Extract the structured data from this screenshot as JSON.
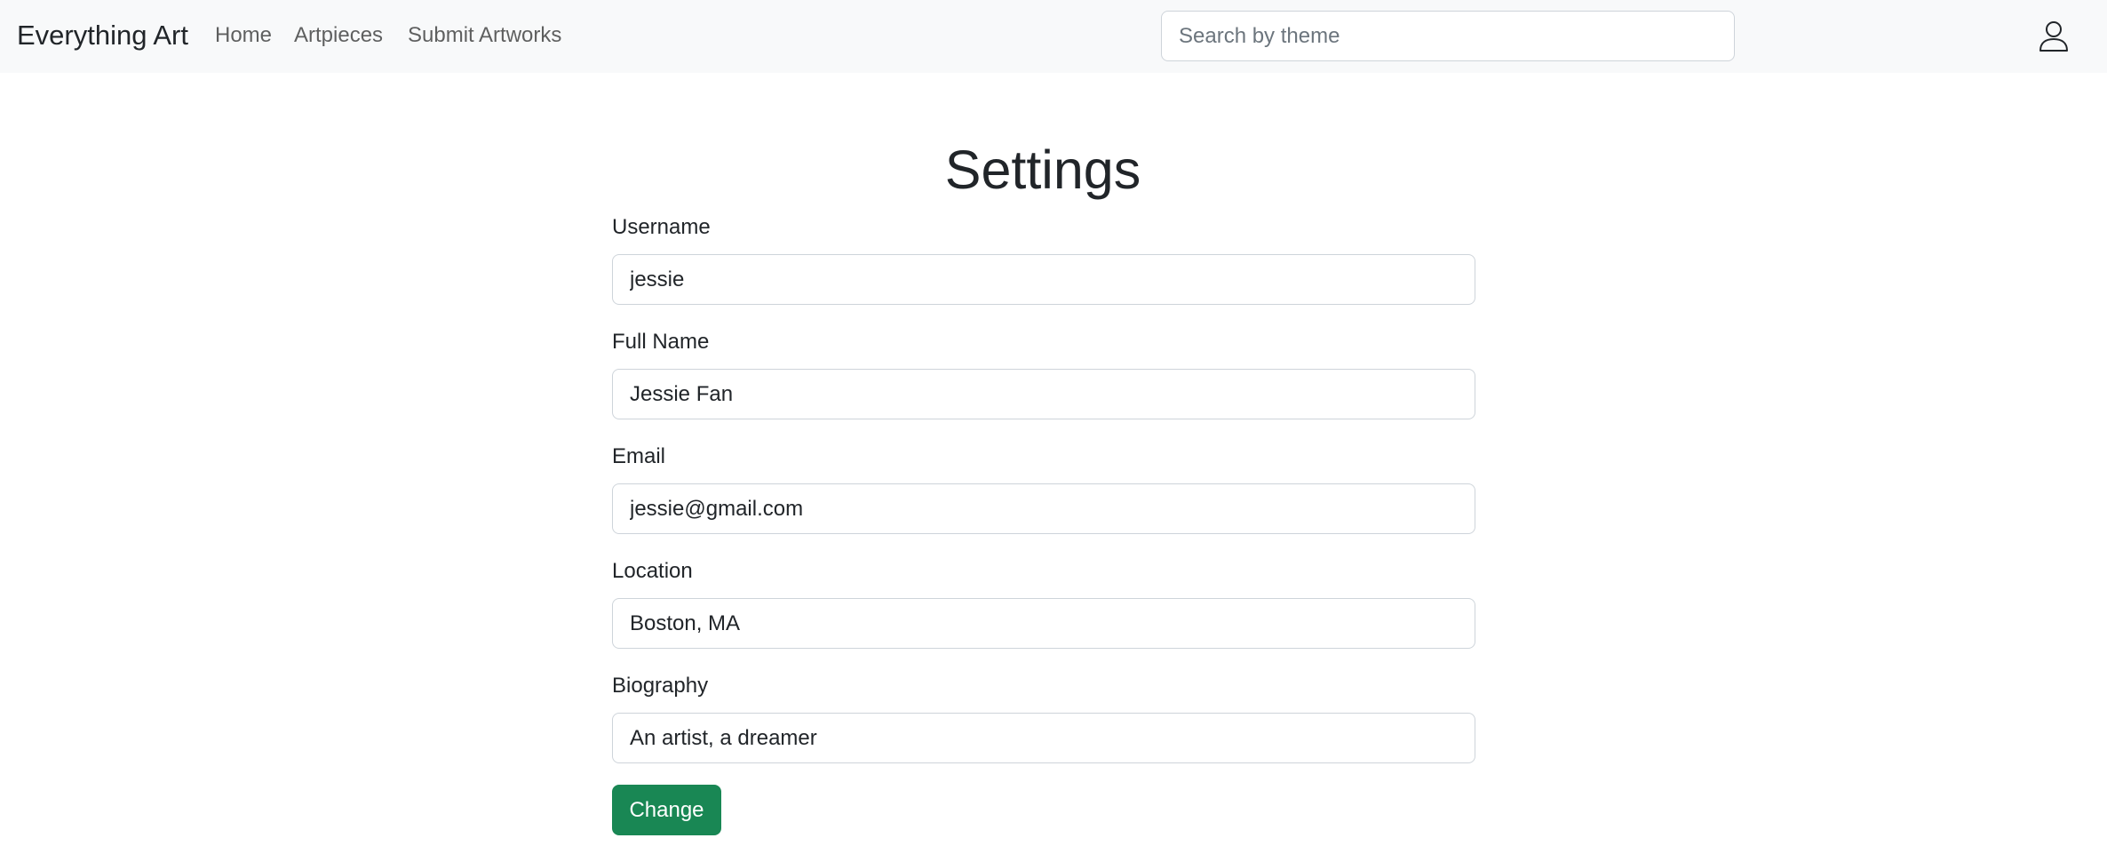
{
  "navbar": {
    "brand": "Everything Art",
    "links": [
      "Home",
      "Artpieces",
      "Submit Artworks"
    ],
    "search": {
      "placeholder": "Search by theme",
      "value": ""
    },
    "user_icon": "person-icon"
  },
  "main": {
    "title": "Settings",
    "fields": [
      {
        "label": "Username",
        "value": "jessie"
      },
      {
        "label": "Full Name",
        "value": "Jessie Fan"
      },
      {
        "label": "Email",
        "value": "jessie@gmail.com"
      },
      {
        "label": "Location",
        "value": "Boston, MA"
      },
      {
        "label": "Biography",
        "value": "An artist, a dreamer"
      }
    ],
    "submit_label": "Change"
  },
  "colors": {
    "navbar_bg": "#f8f9fa",
    "primary_button": "#198754",
    "input_border": "#ced4da",
    "text": "#212529"
  }
}
